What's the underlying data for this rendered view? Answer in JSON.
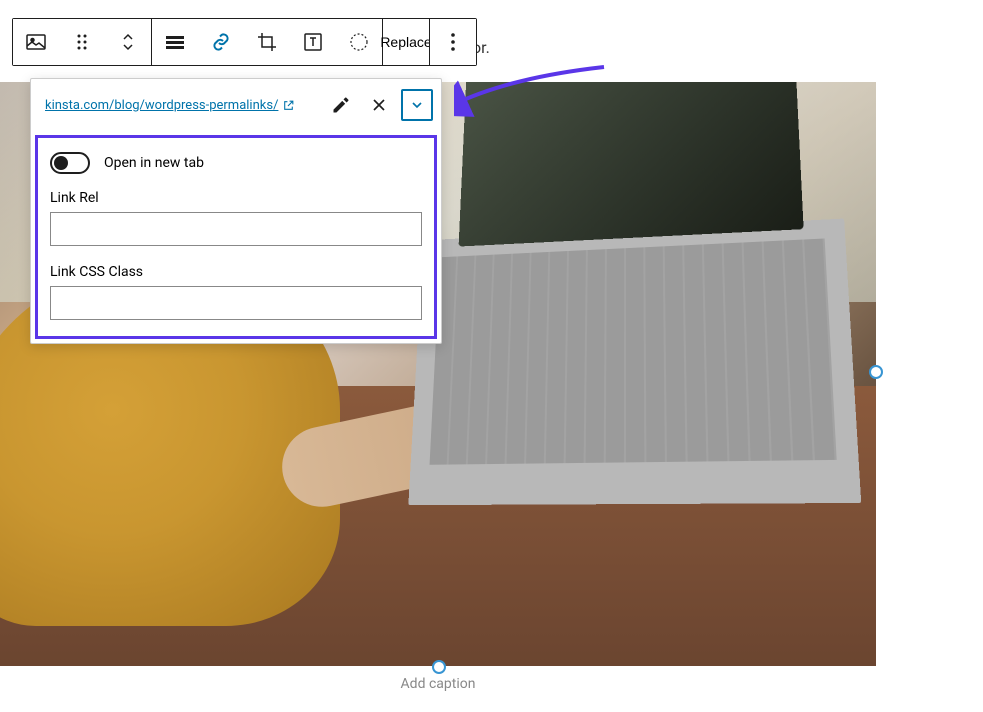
{
  "toolbar": {
    "replace_label": "Replace"
  },
  "background_text_fragment": "or.",
  "link_popover": {
    "url": "kinsta.com/blog/wordpress-permalinks/",
    "open_new_tab_label": "Open in new tab",
    "open_new_tab_state": false,
    "link_rel_label": "Link Rel",
    "link_rel_value": "",
    "link_css_class_label": "Link CSS Class",
    "link_css_class_value": ""
  },
  "caption_placeholder": "Add caption",
  "colors": {
    "accent": "#0073aa",
    "highlight_border": "#5a36e8"
  }
}
